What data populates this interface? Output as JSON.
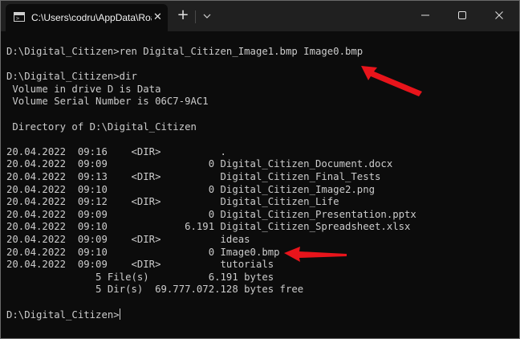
{
  "window": {
    "tab_title": "C:\\Users\\codru\\AppData\\Roaming",
    "tab_close": "✕",
    "new_tab": "+"
  },
  "terminal": {
    "lines": [
      "D:\\Digital_Citizen>ren Digital_Citizen_Image1.bmp Image0.bmp",
      "",
      "D:\\Digital_Citizen>dir",
      " Volume in drive D is Data",
      " Volume Serial Number is 06C7-9AC1",
      "",
      " Directory of D:\\Digital_Citizen",
      "",
      "20.04.2022  09:16    <DIR>          .",
      "20.04.2022  09:09                 0 Digital_Citizen_Document.docx",
      "20.04.2022  09:13    <DIR>          Digital_Citizen_Final_Tests",
      "20.04.2022  09:10                 0 Digital_Citizen_Image2.png",
      "20.04.2022  09:12    <DIR>          Digital_Citizen_Life",
      "20.04.2022  09:09                 0 Digital_Citizen_Presentation.pptx",
      "20.04.2022  09:10             6.191 Digital_Citizen_Spreadsheet.xlsx",
      "20.04.2022  09:09    <DIR>          ideas",
      "20.04.2022  09:10                 0 Image0.bmp",
      "20.04.2022  09:09    <DIR>          tutorials",
      "               5 File(s)          6.191 bytes",
      "               5 Dir(s)  69.777.072.128 bytes free",
      "",
      "D:\\Digital_Citizen>"
    ]
  },
  "colors": {
    "background": "#0c0c0c",
    "text": "#cccccc",
    "titlebar": "#202020",
    "annotation_arrow": "#e8141b"
  }
}
